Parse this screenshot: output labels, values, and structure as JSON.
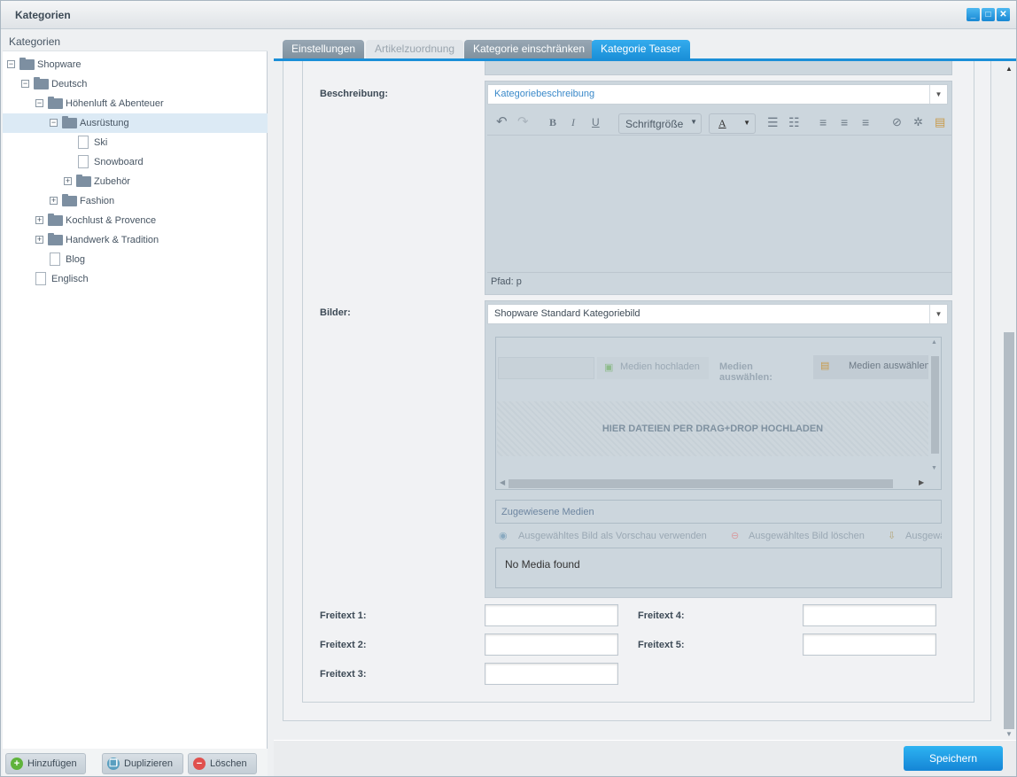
{
  "window": {
    "title": "Kategorien",
    "controls": [
      "minimize",
      "maximize",
      "close"
    ]
  },
  "sidebar": {
    "header": "Kategorien",
    "tree": [
      {
        "label": "Shopware",
        "type": "folder",
        "state": "expanded",
        "level": 0
      },
      {
        "label": "Deutsch",
        "type": "folder",
        "state": "expanded",
        "level": 1
      },
      {
        "label": "Höhenluft & Abenteuer",
        "type": "folder",
        "state": "expanded",
        "level": 2
      },
      {
        "label": "Ausrüstung",
        "type": "folder",
        "state": "expanded",
        "level": 3,
        "selected": true
      },
      {
        "label": "Ski",
        "type": "leaf",
        "level": 4
      },
      {
        "label": "Snowboard",
        "type": "leaf",
        "level": 4
      },
      {
        "label": "Zubehör",
        "type": "folder",
        "state": "collapsed",
        "level": 4
      },
      {
        "label": "Fashion",
        "type": "folder",
        "state": "collapsed",
        "level": 3
      },
      {
        "label": "Kochlust & Provence",
        "type": "folder",
        "state": "collapsed",
        "level": 2
      },
      {
        "label": "Handwerk & Tradition",
        "type": "folder",
        "state": "collapsed",
        "level": 2
      },
      {
        "label": "Blog",
        "type": "leaf",
        "level": 2
      },
      {
        "label": "Englisch",
        "type": "leaf",
        "level": 1
      }
    ],
    "buttons": {
      "add": "Hinzufügen",
      "duplicate": "Duplizieren",
      "delete": "Löschen"
    }
  },
  "tabs": [
    {
      "label": "Einstellungen",
      "state": "normal"
    },
    {
      "label": "Artikelzuordnung",
      "state": "disabled"
    },
    {
      "label": "Kategorie einschränken",
      "state": "normal"
    },
    {
      "label": "Kategorie Teaser",
      "state": "active"
    }
  ],
  "form": {
    "description_label": "Beschreibung:",
    "description_select": "Kategoriebeschreibung",
    "editor": {
      "font_size": "Schriftgröße",
      "font_color": "A",
      "bold": "B",
      "italic": "I",
      "underline": "U",
      "path": "Pfad: p"
    },
    "images_label": "Bilder:",
    "images_select": "Shopware Standard Kategoriebild",
    "media": {
      "upload": "Medien hochladen",
      "select_label": "Medien auswählen:",
      "select_button": "Medien auswählen",
      "dropzone": "HIER DATEIEN PER DRAG+DROP HOCHLADEN",
      "assigned_title": "Zugewiesene Medien",
      "preview_action": "Ausgewähltes Bild als Vorschau verwenden",
      "delete_action": "Ausgewähltes Bild löschen",
      "third_action": "Ausgewä",
      "empty": "No Media found"
    },
    "freetext": [
      {
        "label": "Freitext 1:",
        "value": ""
      },
      {
        "label": "Freitext 2:",
        "value": ""
      },
      {
        "label": "Freitext 3:",
        "value": ""
      },
      {
        "label": "Freitext 4:",
        "value": ""
      },
      {
        "label": "Freitext 5:",
        "value": ""
      }
    ]
  },
  "footer": {
    "save": "Speichern"
  },
  "colors": {
    "accent": "#1a8fd8",
    "selected_row": "#dceaf5"
  }
}
